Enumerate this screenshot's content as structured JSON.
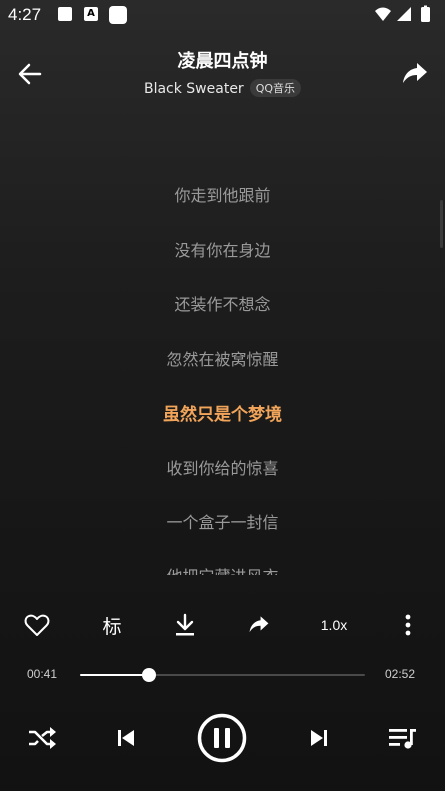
{
  "status_bar": {
    "time": "4:27",
    "notification_icons": [
      "square-icon",
      "a-icon",
      "square-icon"
    ]
  },
  "header": {
    "title": "凌晨四点钟",
    "artist": "Black Sweater",
    "source": "QQ音乐"
  },
  "lyrics": {
    "lines": [
      "你走到他跟前",
      "没有你在身边",
      "还装作不想念",
      "忽然在被窝惊醒",
      "虽然只是个梦境",
      "收到你给的惊喜",
      "一个盒子一封信",
      "他把它藏进风衣"
    ],
    "current_index": 4
  },
  "actions": {
    "mark_label": "标",
    "speed_label": "1.0x"
  },
  "progress": {
    "elapsed": "00:41",
    "total": "02:52",
    "fraction": 0.243
  },
  "colors": {
    "highlight": "#f2a55a",
    "background": "#1a1a1a"
  }
}
